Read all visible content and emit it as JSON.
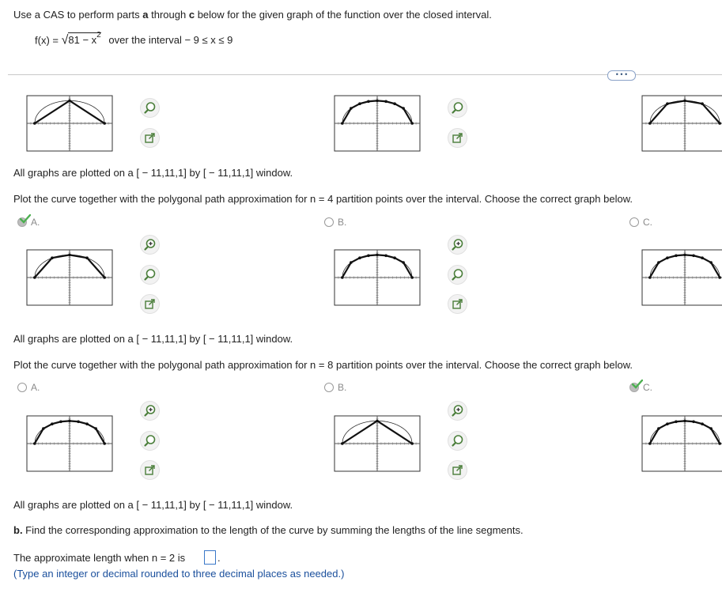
{
  "problem": {
    "intro_pre": "Use a CAS to perform parts ",
    "intro_a": "a",
    "intro_mid": " through ",
    "intro_c": "c",
    "intro_post": " below for the given graph of the function over the closed interval.",
    "function_lhs": "f(x) = ",
    "function_rad": "81 − x",
    "function_exp": "2",
    "interval": "over the interval  − 9 ≤ x ≤ 9"
  },
  "more_button": "• • •",
  "sections": [
    {
      "window_note": "All graphs are plotted on a [ − 11,11,1] by [ − 11,11,1] window.",
      "question": "Plot the curve together with the polygonal path approximation for n = 4 partition points over the interval. Choose the correct graph below.",
      "options": [
        {
          "label": "A.",
          "selected": true
        },
        {
          "label": "B.",
          "selected": false
        },
        {
          "label": "C.",
          "selected": false
        }
      ]
    },
    {
      "window_note": "All graphs are plotted on a [ − 11,11,1] by [ − 11,11,1] window.",
      "question": "Plot the curve together with the polygonal path approximation for n = 8 partition points over the interval. Choose the correct graph below.",
      "options": [
        {
          "label": "A.",
          "selected": false
        },
        {
          "label": "B.",
          "selected": false
        },
        {
          "label": "C.",
          "selected": true
        }
      ]
    }
  ],
  "final_window_note": "All graphs are plotted on a [ − 11,11,1] by [ − 11,11,1] window.",
  "part_b": {
    "label": "b.",
    "text": " Find the corresponding approximation to the length of the curve by summing the lengths of the line segments.",
    "answer_prefix": "The approximate length when n = 2 is ",
    "answer_suffix": ".",
    "answer_value": "",
    "hint": "(Type an integer or decimal rounded to three decimal places as needed.)"
  },
  "colors": {
    "check": "#4caf50",
    "blue_text": "#1a4f9c",
    "input_border": "#3a78c8"
  },
  "icons": [
    "zoom-in-icon",
    "zoom-out-icon",
    "external-link-icon",
    "check-icon"
  ],
  "graphs": {
    "top_row": [
      {
        "segments": 2
      },
      {
        "segments": 8
      },
      {
        "segments": 4
      }
    ],
    "mid_row": [
      {
        "segments": 4
      },
      {
        "segments": 8
      },
      {
        "segments": 8
      }
    ],
    "bottom_row": [
      {
        "segments": 8
      },
      {
        "segments": 2
      },
      {
        "segments": 8
      }
    ]
  }
}
